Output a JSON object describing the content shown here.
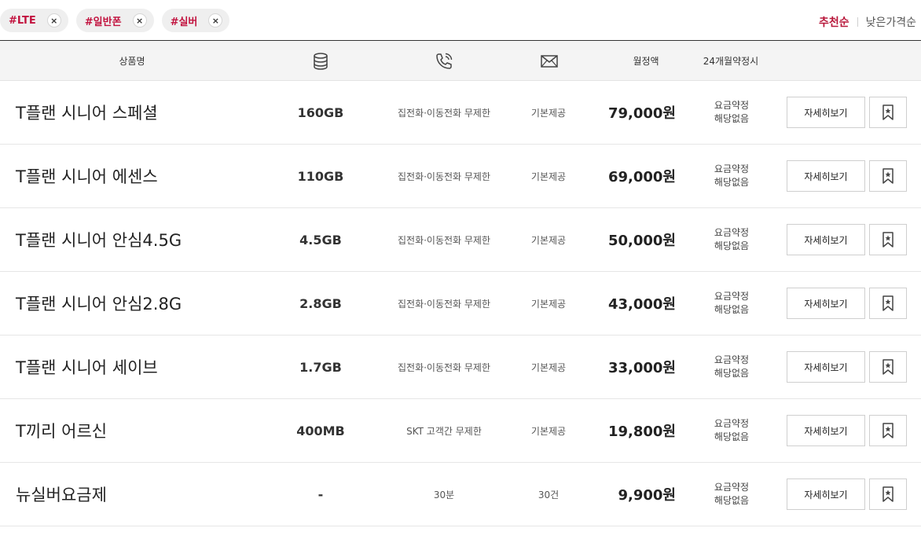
{
  "filters": {
    "tags": [
      {
        "label": "#LTE",
        "close_glyph": "×"
      },
      {
        "label": "#일반폰",
        "close_glyph": "×"
      },
      {
        "label": "#실버",
        "close_glyph": "×"
      }
    ],
    "sort_active": "추천순",
    "sort_inactive": "낮은가격순"
  },
  "header": {
    "name": "상품명",
    "data_icon": "database-icon",
    "voice_icon": "phone-ringing-icon",
    "sms_icon": "envelope-icon",
    "monthly": "월정액",
    "contract": "24개월약정시"
  },
  "plans": [
    {
      "name": "T플랜 시니어 스페셜",
      "data": "160GB",
      "voice": "집전화·이동전화 무제한",
      "sms": "기본제공",
      "price": "79,000원",
      "note1": "요금약정",
      "note2": "해당없음",
      "detail": "자세히보기"
    },
    {
      "name": "T플랜 시니어 에센스",
      "data": "110GB",
      "voice": "집전화·이동전화 무제한",
      "sms": "기본제공",
      "price": "69,000원",
      "note1": "요금약정",
      "note2": "해당없음",
      "detail": "자세히보기"
    },
    {
      "name": "T플랜 시니어 안심4.5G",
      "data": "4.5GB",
      "voice": "집전화·이동전화 무제한",
      "sms": "기본제공",
      "price": "50,000원",
      "note1": "요금약정",
      "note2": "해당없음",
      "detail": "자세히보기"
    },
    {
      "name": "T플랜 시니어 안심2.8G",
      "data": "2.8GB",
      "voice": "집전화·이동전화 무제한",
      "sms": "기본제공",
      "price": "43,000원",
      "note1": "요금약정",
      "note2": "해당없음",
      "detail": "자세히보기"
    },
    {
      "name": "T플랜 시니어 세이브",
      "data": "1.7GB",
      "voice": "집전화·이동전화 무제한",
      "sms": "기본제공",
      "price": "33,000원",
      "note1": "요금약정",
      "note2": "해당없음",
      "detail": "자세히보기"
    },
    {
      "name": "T끼리 어르신",
      "data": "400MB",
      "voice": "SKT 고객간 무제한",
      "sms": "기본제공",
      "price": "19,800원",
      "note1": "요금약정",
      "note2": "해당없음",
      "detail": "자세히보기"
    },
    {
      "name": "뉴실버요금제",
      "data": "-",
      "voice": "30분",
      "sms": "30건",
      "price": "9,900원",
      "note1": "요금약정",
      "note2": "해당없음",
      "detail": "자세히보기"
    }
  ],
  "colors": {
    "accent": "#b8183b",
    "tag_text": "#c2133f"
  }
}
